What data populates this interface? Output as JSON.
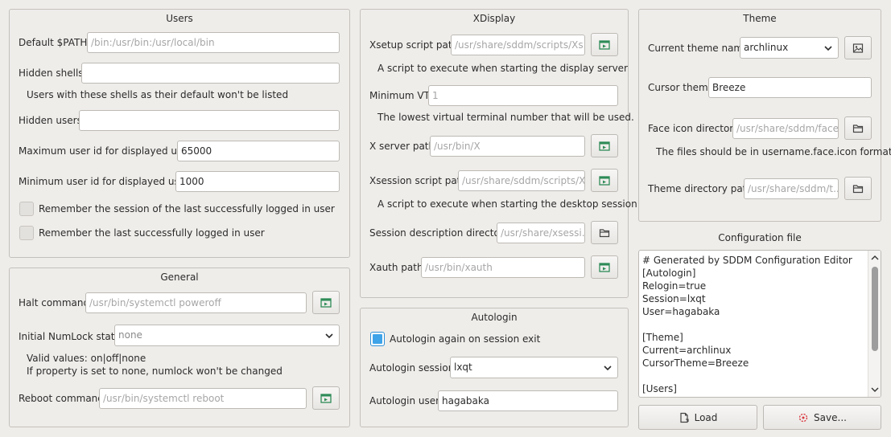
{
  "users": {
    "title": "Users",
    "default_path_label": "Default $PATH",
    "default_path_placeholder": "/bin:/usr/bin:/usr/local/bin",
    "hidden_shells_label": "Hidden shells",
    "hidden_shells_value": "",
    "hidden_shells_hint": "Users with these shells as their default won't be listed",
    "hidden_users_label": "Hidden users",
    "hidden_users_value": "",
    "max_uid_label": "Maximum user id for displayed users",
    "max_uid_value": "65000",
    "min_uid_label": "Minimum user id for displayed users",
    "min_uid_value": "1000",
    "remember_session_label": "Remember the session of the last successfully logged in user",
    "remember_session_checked": false,
    "remember_user_label": "Remember the last successfully logged in user",
    "remember_user_checked": false
  },
  "general": {
    "title": "General",
    "halt_label": "Halt command",
    "halt_placeholder": "/usr/bin/systemctl poweroff",
    "numlock_label": "Initial NumLock state",
    "numlock_value": "none",
    "numlock_hint1": "Valid values: on|off|none",
    "numlock_hint2": "If property is set to none, numlock won't be changed",
    "reboot_label": "Reboot command",
    "reboot_placeholder": "/usr/bin/systemctl reboot"
  },
  "xdisplay": {
    "title": "XDisplay",
    "xsetup_label": "Xsetup script path",
    "xsetup_placeholder": "/usr/share/sddm/scripts/Xs...",
    "xsetup_hint": "A script to execute when starting the display server",
    "min_vt_label": "Minimum VT",
    "min_vt_placeholder": "1",
    "min_vt_hint": "The lowest virtual terminal number that will be used.",
    "xserver_label": "X server path",
    "xserver_placeholder": "/usr/bin/X",
    "xsession_label": "Xsession script path",
    "xsession_placeholder": "/usr/share/sddm/scripts/X...",
    "xsession_hint": "A script to execute when starting the desktop session",
    "session_dir_label": "Session description directory",
    "session_dir_placeholder": "/usr/share/xsessi...",
    "xauth_label": "Xauth path",
    "xauth_placeholder": "/usr/bin/xauth"
  },
  "autologin": {
    "title": "Autologin",
    "relogin_label": "Autologin again on session exit",
    "relogin_checked": true,
    "session_label": "Autologin session",
    "session_value": "lxqt",
    "user_label": "Autologin user",
    "user_value": "hagabaka"
  },
  "theme": {
    "title": "Theme",
    "current_label": "Current theme name",
    "current_value": "archlinux",
    "cursor_label": "Cursor theme",
    "cursor_value": "Breeze",
    "face_label": "Face icon directory",
    "face_placeholder": "/usr/share/sddm/faces",
    "face_hint": "The files should be in username.face.icon format",
    "dir_label": "Theme directory path",
    "dir_placeholder": "/usr/share/sddm/t..."
  },
  "config": {
    "title": "Configuration file",
    "lines": [
      "# Generated by SDDM Configuration Editor",
      "[Autologin]",
      "Relogin=true",
      "Session=lxqt",
      "User=hagabaka",
      "",
      "[Theme]",
      "Current=archlinux",
      "CursorTheme=Breeze",
      "",
      "[Users]"
    ]
  },
  "buttons": {
    "load_label": "Load",
    "save_label": "Save..."
  },
  "icons": {
    "exec": "run-program-icon",
    "folder": "folder-icon",
    "image": "image-preview-icon",
    "load": "document-open-icon",
    "save": "document-save-icon"
  },
  "colors": {
    "accent": "#3ea3e8",
    "exec_icon": "#2e8b57"
  }
}
